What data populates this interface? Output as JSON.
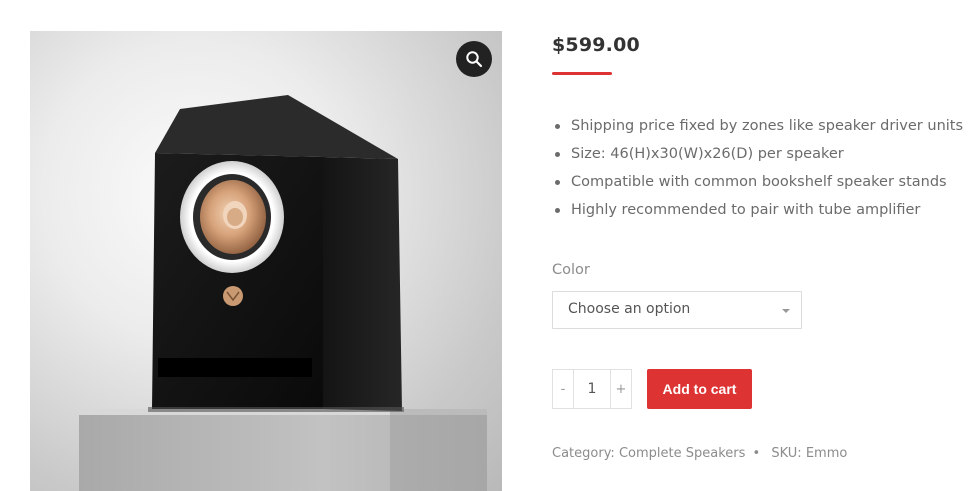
{
  "product": {
    "price": "$599.00",
    "features": [
      "Shipping price fixed by zones like speaker driver units",
      "Size: 46(H)x30(W)x26(D) per speaker",
      "Compatible with common bookshelf speaker stands",
      "Highly recommended to pair with tube amplifier"
    ],
    "variation": {
      "label": "Color",
      "selected": "Choose an option"
    },
    "quantity": {
      "minus": "-",
      "value": "1",
      "plus": "+"
    },
    "add_to_cart_label": "Add to cart",
    "meta": {
      "category_label": "Category:",
      "category_value": "Complete Speakers",
      "separator": "•",
      "sku_label": "SKU:",
      "sku_value": "Emmo"
    }
  },
  "gallery": {
    "zoom_icon": "magnifier-icon"
  },
  "colors": {
    "accent": "#dd3333",
    "text": "#6b6b6b",
    "price": "#333333"
  }
}
